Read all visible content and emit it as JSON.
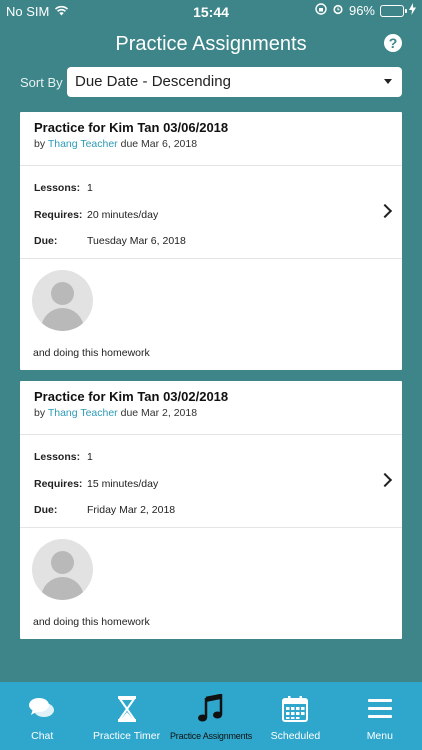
{
  "status_bar": {
    "carrier": "No SIM",
    "time": "15:44",
    "battery": "96%",
    "battery_level": 0.96
  },
  "header": {
    "title": "Practice Assignments",
    "help_icon": "question-circle-icon"
  },
  "sort": {
    "label": "Sort By",
    "selected": "Due Date - Descending"
  },
  "assignments": [
    {
      "title": "Practice for Kim Tan 03/06/2018",
      "by_prefix": "by",
      "teacher": "Thang Teacher",
      "due_short": "due Mar 6, 2018",
      "lessons_label": "Lessons:",
      "lessons": "1",
      "requires_label": "Requires:",
      "requires": "20 minutes/day",
      "due_label": "Due:",
      "due": "Tuesday Mar 6, 2018",
      "note": "and doing this homework"
    },
    {
      "title": "Practice for Kim Tan 03/02/2018",
      "by_prefix": "by",
      "teacher": "Thang Teacher",
      "due_short": "due Mar 2, 2018",
      "lessons_label": "Lessons:",
      "lessons": "1",
      "requires_label": "Requires:",
      "requires": "15 minutes/day",
      "due_label": "Due:",
      "due": "Friday Mar 2, 2018",
      "note": "and doing this homework"
    }
  ],
  "tabs": [
    {
      "label": "Chat",
      "icon": "chat-bubbles-icon",
      "active": false
    },
    {
      "label": "Practice Timer",
      "icon": "hourglass-icon",
      "active": false
    },
    {
      "label": "Practice Assignments",
      "icon": "music-note-icon",
      "active": true
    },
    {
      "label": "Scheduled",
      "icon": "calendar-icon",
      "active": false
    },
    {
      "label": "Menu",
      "icon": "hamburger-menu-icon",
      "active": false
    }
  ],
  "colors": {
    "background": "#3d8589",
    "tab_bar": "#2fa7cd",
    "teacher_link": "#2c9ab5"
  }
}
